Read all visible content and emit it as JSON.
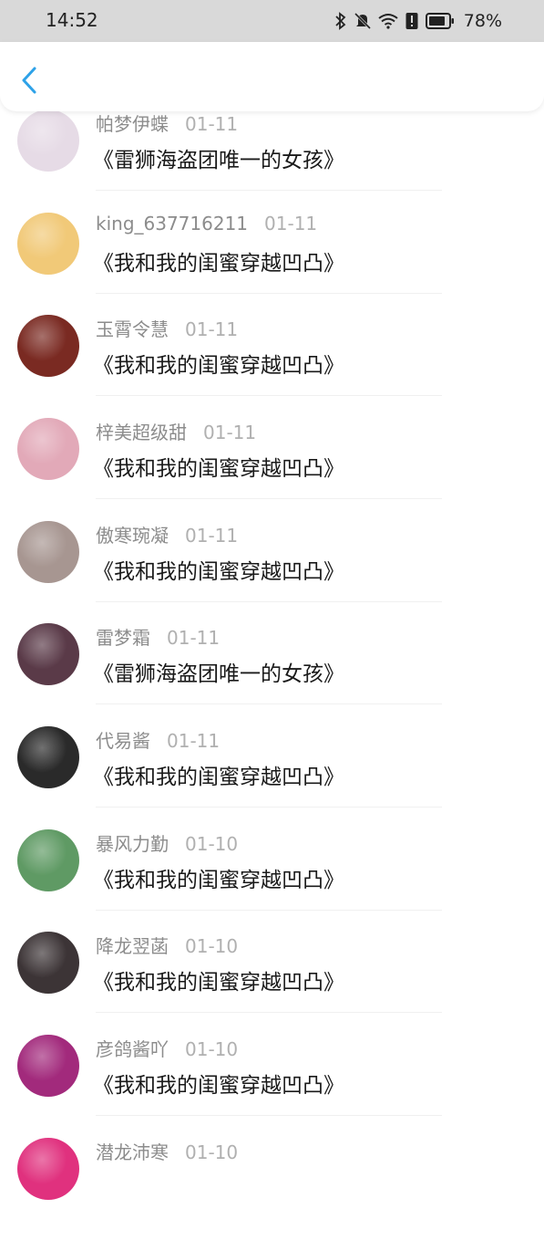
{
  "status": {
    "time": "14:52",
    "battery": "78%"
  },
  "colors": {
    "accent": "#2ea2e8",
    "status_bg": "#d9d9d9"
  },
  "header": {
    "back_icon": "chevron-left-icon"
  },
  "items": [
    {
      "name": "帕梦伊蝶",
      "date": "01-11",
      "title": "《雷狮海盗团唯一的女孩》",
      "avatar_color": "#e6dbe6"
    },
    {
      "name": "king_637716211",
      "date": "01-11",
      "title": "《我和我的闺蜜穿越凹凸》",
      "avatar_color": "#f1c978"
    },
    {
      "name": "玉霄令慧",
      "date": "01-11",
      "title": "《我和我的闺蜜穿越凹凸》",
      "avatar_color": "#7a2a22"
    },
    {
      "name": "梓美超级甜",
      "date": "01-11",
      "title": "《我和我的闺蜜穿越凹凸》",
      "avatar_color": "#e2a9b8"
    },
    {
      "name": "傲寒琬凝",
      "date": "01-11",
      "title": "《我和我的闺蜜穿越凹凸》",
      "avatar_color": "#a79691"
    },
    {
      "name": "雷梦霜",
      "date": "01-11",
      "title": "《雷狮海盗团唯一的女孩》",
      "avatar_color": "#5a3a48"
    },
    {
      "name": "代易酱",
      "date": "01-11",
      "title": "《我和我的闺蜜穿越凹凸》",
      "avatar_color": "#2a2a2a"
    },
    {
      "name": "暴风力勤",
      "date": "01-10",
      "title": "《我和我的闺蜜穿越凹凸》",
      "avatar_color": "#5f9a64"
    },
    {
      "name": "降龙翌菡",
      "date": "01-10",
      "title": "《我和我的闺蜜穿越凹凸》",
      "avatar_color": "#3c3436"
    },
    {
      "name": "彦鸽酱吖",
      "date": "01-10",
      "title": "《我和我的闺蜜穿越凹凸》",
      "avatar_color": "#a22a7c"
    },
    {
      "name": "潜龙沛寒",
      "date": "01-10",
      "title": "",
      "avatar_color": "#e0317e"
    }
  ]
}
